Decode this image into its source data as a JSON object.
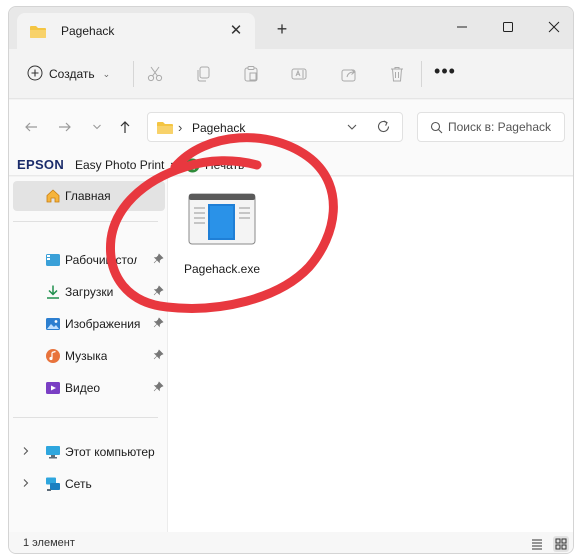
{
  "window": {
    "tab_title": "Pagehack",
    "colors": {
      "accent": "#0067c0",
      "highlight": "#e8383f",
      "folder": "#f4c542"
    }
  },
  "toolbar": {
    "create_label": "Создать",
    "icons": [
      "cut-icon",
      "copy-icon",
      "paste-icon",
      "rename-icon",
      "share-icon",
      "delete-icon"
    ]
  },
  "address": {
    "crumb": "Pagehack",
    "search_placeholder": "Поиск в: Pagehack"
  },
  "epson": {
    "logo": "EPSON",
    "app": "Easy Photo Print",
    "print": "Печать"
  },
  "sidebar": {
    "items": [
      {
        "label": "Главная",
        "icon": "home-icon",
        "active": true
      },
      {
        "label": "Рабочий стол",
        "icon": "desktop-icon",
        "pinned": true
      },
      {
        "label": "Загрузки",
        "icon": "download-icon",
        "pinned": true
      },
      {
        "label": "Изображения",
        "icon": "pictures-icon",
        "pinned": true
      },
      {
        "label": "Музыка",
        "icon": "music-icon",
        "pinned": true
      },
      {
        "label": "Видео",
        "icon": "video-icon",
        "pinned": true
      },
      {
        "label": "Этот компьютер",
        "icon": "computer-icon",
        "expandable": true
      },
      {
        "label": "Сеть",
        "icon": "network-icon",
        "expandable": true
      }
    ]
  },
  "content": {
    "files": [
      {
        "name": "Pagehack.exe",
        "icon": "exe-file-icon"
      }
    ]
  },
  "status": {
    "count": "1 элемент"
  }
}
